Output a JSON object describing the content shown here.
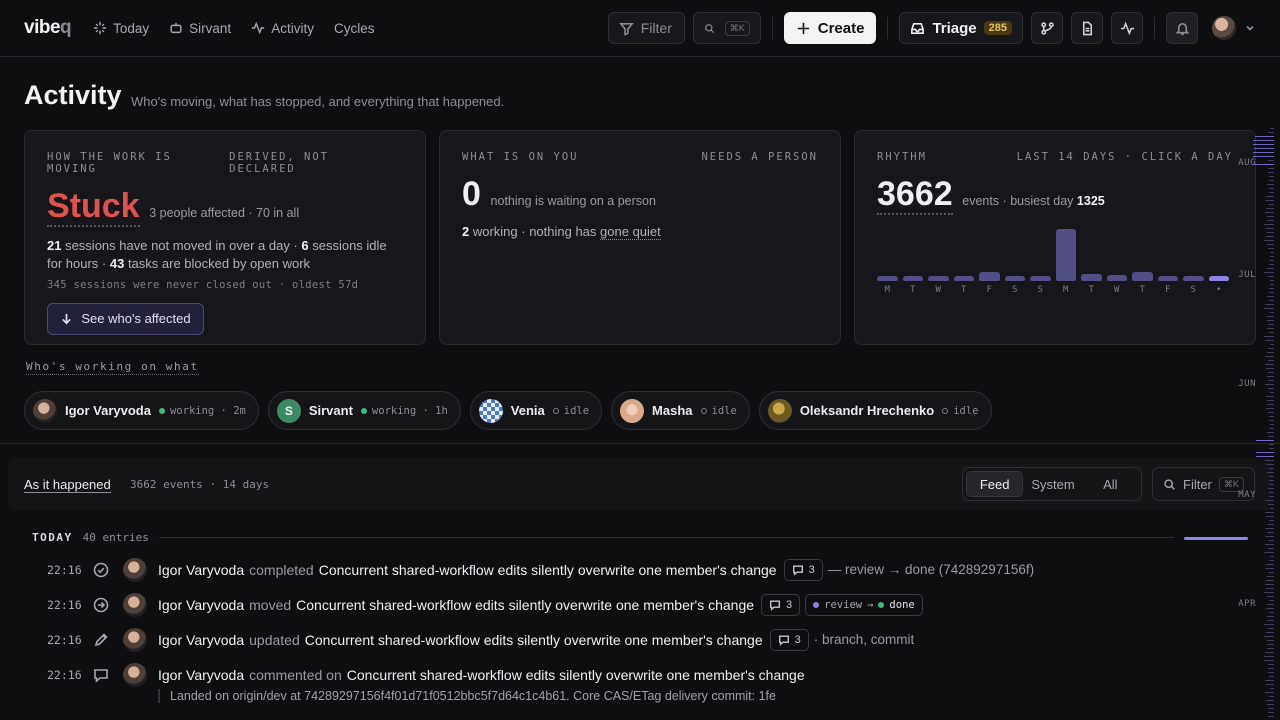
{
  "app": {
    "logo_main": "vibe",
    "logo_q": "q"
  },
  "nav": [
    {
      "label": "Today",
      "icon": "sparkle-icon"
    },
    {
      "label": "Sirvant",
      "icon": "bot-icon"
    },
    {
      "label": "Activity",
      "icon": "pulse-icon"
    },
    {
      "label": "Cycles",
      "icon": ""
    }
  ],
  "toolbar": {
    "filter_label": "Filter",
    "search_kbd": "⌘K",
    "create_label": "Create",
    "triage_label": "Triage",
    "triage_count": "285"
  },
  "page": {
    "title": "Activity",
    "subtitle": "Who's moving, what has stopped, and everything that happened."
  },
  "cards": {
    "moving": {
      "head_left": "HOW THE WORK IS MOVING",
      "head_right": "DERIVED, NOT DECLARED",
      "big": "Stuck",
      "aside": "3 people affected · 70 in all",
      "n1": "21",
      "t1": " sessions have not moved in over a day · ",
      "n2": "6",
      "t2": " sessions idle for hours · ",
      "n3": "43",
      "t3": " tasks are blocked by open work",
      "mono": "345 sessions were never closed out · oldest 57d",
      "button": "See who's affected"
    },
    "on_you": {
      "head_left": "WHAT IS ON YOU",
      "head_right": "NEEDS A PERSON",
      "big": "0",
      "aside": "nothing is waiting on a person",
      "n1": "2",
      "t1": " working · nothing has ",
      "link": "gone quiet"
    },
    "rhythm": {
      "head_left": "RHYTHM",
      "head_right": "LAST 14 DAYS · CLICK A DAY",
      "big": "3662",
      "aside": "events · busiest day ",
      "busiest": "1325"
    }
  },
  "chart_data": {
    "type": "bar",
    "categories": [
      "M",
      "T",
      "W",
      "T",
      "F",
      "S",
      "S",
      "M",
      "T",
      "W",
      "T",
      "F",
      "S",
      "•"
    ],
    "values": [
      80,
      80,
      80,
      80,
      230,
      70,
      70,
      1325,
      190,
      160,
      230,
      70,
      70,
      90
    ],
    "title": "",
    "colors": {
      "bar": "#524f86",
      "today": "#8c86e0"
    }
  },
  "who": {
    "title": "Who's working on what",
    "people": [
      {
        "name": "Igor Varyvoda",
        "status": "working · 2m",
        "state": "working",
        "avatar": "photo-avatar"
      },
      {
        "name": "Sirvant",
        "status": "working · 1h",
        "state": "working",
        "avatar": "letter-avatar",
        "initial": "S"
      },
      {
        "name": "Venia",
        "status": "idle",
        "state": "idle",
        "avatar": "pattern-avatar"
      },
      {
        "name": "Masha",
        "status": "idle",
        "state": "idle",
        "avatar": "face-avatar"
      },
      {
        "name": "Oleksandr Hrechenko",
        "status": "idle",
        "state": "idle",
        "avatar": "gold-avatar"
      }
    ]
  },
  "feed": {
    "title": "As it happened",
    "meta": "3662 events · 14 days",
    "tabs": [
      "Feed",
      "System",
      "All"
    ],
    "active_tab": "Feed",
    "filter_label": "Filter",
    "filter_kbd": "⌘K",
    "today_label": "TODAY",
    "today_count": "40 entries"
  },
  "events": [
    {
      "time": "22:16",
      "icon": "check-circle-icon",
      "actor": "Igor Varyvoda",
      "verb": "completed",
      "target": "Concurrent shared-workflow edits silently overwrite one member's change",
      "comments": "3",
      "tail": "— review → done (74289297156f)"
    },
    {
      "time": "22:16",
      "icon": "arrow-circle-icon",
      "actor": "Igor Varyvoda",
      "verb": "moved",
      "target": "Concurrent shared-workflow edits silently overwrite one member's change",
      "comments": "3",
      "from": "review",
      "to": "done"
    },
    {
      "time": "22:16",
      "icon": "pencil-icon",
      "actor": "Igor Varyvoda",
      "verb": "updated",
      "target": "Concurrent shared-workflow edits silently overwrite one member's change",
      "comments": "3",
      "tail": "· branch, commit"
    },
    {
      "time": "22:16",
      "icon": "comment-icon",
      "actor": "Igor Varyvoda",
      "verb": "commented on",
      "target": "Concurrent shared-workflow edits silently overwrite one member's change",
      "quote": "Landed on origin/dev at 74289297156f4f01d71f0512bbc5f7d64c1c4b61. Core CAS/ETag delivery commit: 1fe"
    }
  ],
  "timeline": {
    "months": [
      "AUG",
      "JUL",
      "JUN",
      "MAY",
      "APR"
    ]
  }
}
